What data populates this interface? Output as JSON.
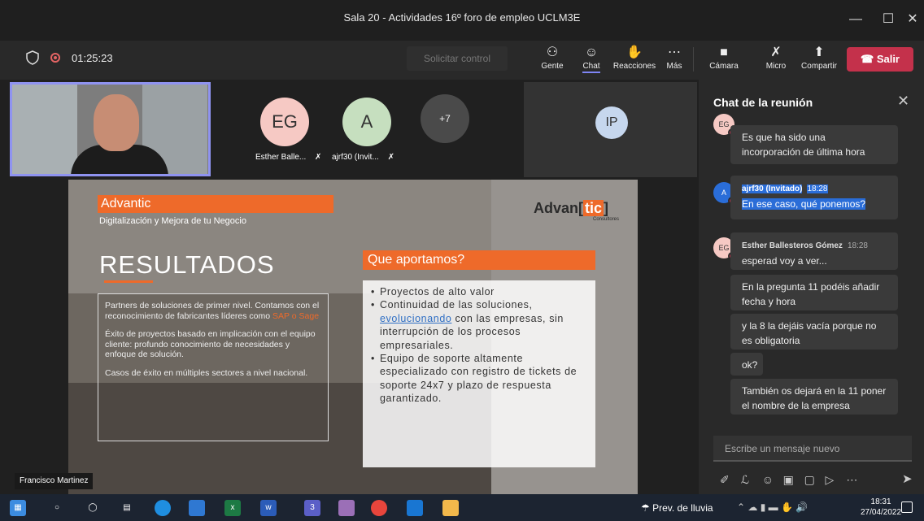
{
  "window": {
    "title": "Sala 20 - Actividades 16º foro de empleo UCLM3E",
    "minimize": "—",
    "maximize": "☐",
    "close": "✕"
  },
  "toolbar": {
    "timer": "01:25:23",
    "request_control": "Solicitar control",
    "people": "Gente",
    "chat": "Chat",
    "reactions": "Reacciones",
    "more": "Más",
    "camera": "Cámara",
    "mic": "Micro",
    "share": "Compartir",
    "leave": "Salir"
  },
  "participants": {
    "eg_initials": "EG",
    "eg_name": "Esther Balle...",
    "a_initials": "A",
    "a_name": "ajrf30 (Invit...",
    "more_count": "+7",
    "ip_initials": "IP",
    "presenter_name": "Francisco Martinez"
  },
  "slide": {
    "brand_title": "Advantic",
    "brand_subtitle": "Digitalización y Mejora de tu Negocio",
    "logo_main": "Advan",
    "logo_tic": "tic",
    "logo_sub": "Consultores",
    "heading": "RESULTADOS",
    "left_p1_a": "Partners de soluciones de primer nivel. Contamos con el reconocimiento de fabricantes líderes como ",
    "left_p1_sap": "SAP o Sage",
    "left_p2": "Éxito de proyectos basado en implicación con el equipo cliente: profundo conocimiento de necesidades y enfoque de solución.",
    "left_p3": "Casos de éxito en múltiples sectores a nivel nacional.",
    "right_title": "Que aportamos?",
    "bullet1": "Proyectos de alto valor",
    "bullet2_a": "Continuidad de las soluciones, ",
    "bullet2_link": "evolucionando",
    "bullet2_b": " con las empresas, sin interrupción de los procesos empresariales.",
    "bullet3": "Equipo de soporte altamente especializado con registro de tickets de soporte 24x7 y plazo de respuesta garantizado."
  },
  "chat": {
    "title": "Chat de la reunión",
    "msg1_av": "EG",
    "msg1_text": "Es que ha sido una incorporación de última hora",
    "msg2_av": "A",
    "msg2_author": "ajrf30 (Invitado)",
    "msg2_time": "18:28",
    "msg2_text": "En ese caso, qué ponemos?",
    "msg3_av": "EG",
    "msg3_author": "Esther Ballesteros Gómez",
    "msg3_time": "18:28",
    "msg3_text": "esperad voy a ver...",
    "msg4_text": "En la pregunta 11 podéis añadir fecha y hora",
    "msg5_text": "y la 8 la dejáis vacía porque no es obligatoria",
    "msg6_text": "ok?",
    "msg7_text": "También os dejará en la 11 poner el nombre de la empresa",
    "input_placeholder": "Escribe un mensaje nuevo"
  },
  "taskbar": {
    "weather": "Prev. de lluvia",
    "time": "18:31",
    "date": "27/04/2022",
    "teams_badge": "3"
  },
  "colors": {
    "accent": "#7f85f5",
    "leave": "#c4314b",
    "slide_orange": "#ee6a2a",
    "highlight": "#2a6dd8"
  }
}
